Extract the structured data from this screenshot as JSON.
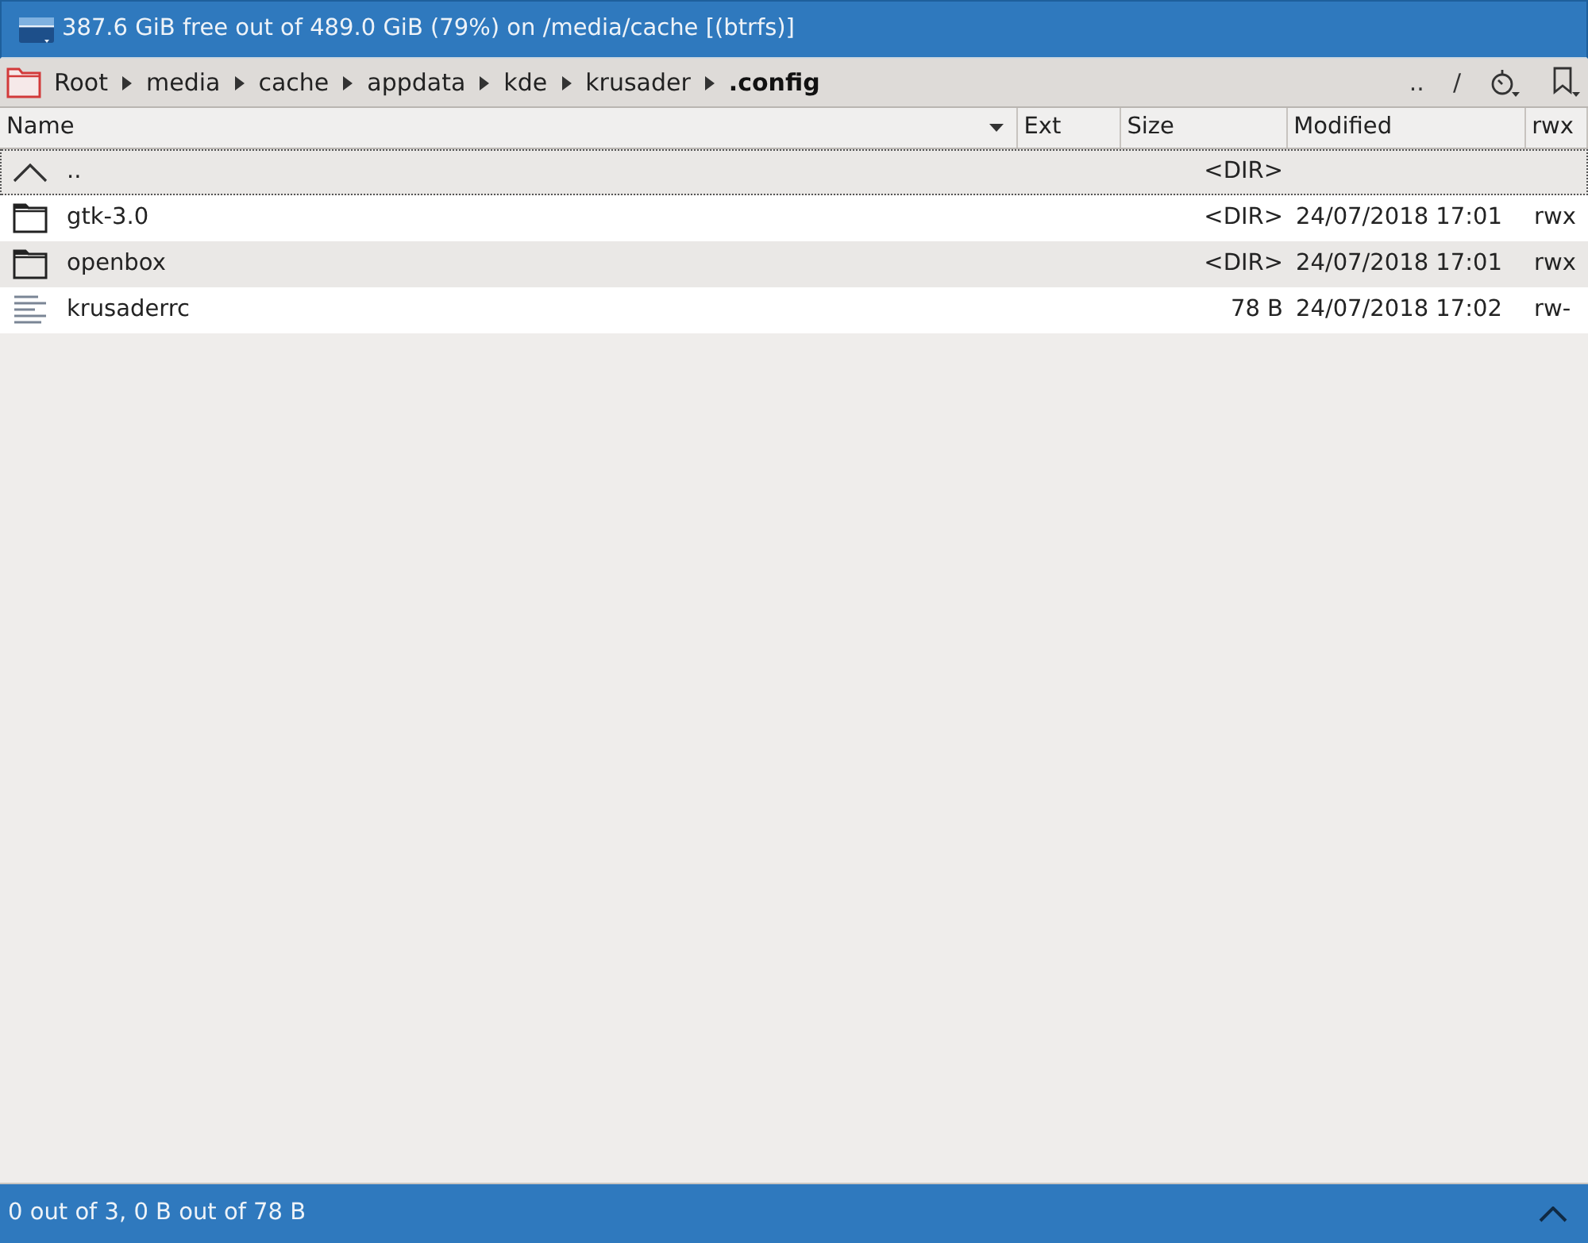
{
  "free_space_bar": {
    "text": "387.6 GiB free out of 489.0 GiB (79%) on /media/cache [(btrfs)]"
  },
  "breadcrumb": {
    "crumbs": [
      {
        "label": "Root",
        "current": false
      },
      {
        "label": "media",
        "current": false
      },
      {
        "label": "cache",
        "current": false
      },
      {
        "label": "appdata",
        "current": false
      },
      {
        "label": "kde",
        "current": false
      },
      {
        "label": "krusader",
        "current": false
      },
      {
        "label": ".config",
        "current": true
      }
    ],
    "nav_buttons": [
      "..",
      "/"
    ]
  },
  "list": {
    "columns": [
      {
        "label": "Name",
        "sorted": true
      },
      {
        "label": "Ext",
        "sorted": false
      },
      {
        "label": "Size",
        "sorted": false
      },
      {
        "label": "Modified",
        "sorted": false
      },
      {
        "label": "rwx",
        "sorted": false
      }
    ],
    "rows": [
      {
        "kind": "up",
        "name": "..",
        "size": "<DIR>",
        "current": true
      },
      {
        "kind": "folder",
        "name": "gtk-3.0",
        "size": "<DIR>",
        "modified": "24/07/2018 17:01",
        "rwx": "rwx",
        "current": false
      },
      {
        "kind": "folder",
        "name": "openbox",
        "size": "<DIR>",
        "modified": "24/07/2018 17:01",
        "rwx": "rwx",
        "current": false
      },
      {
        "kind": "file",
        "name": "krusaderrc",
        "size": "78 B",
        "modified": "24/07/2018 17:02",
        "rwx": "rw-",
        "current": false
      }
    ]
  },
  "status_bar": {
    "text": "0 out of 3, 0 B out of 78 B"
  }
}
